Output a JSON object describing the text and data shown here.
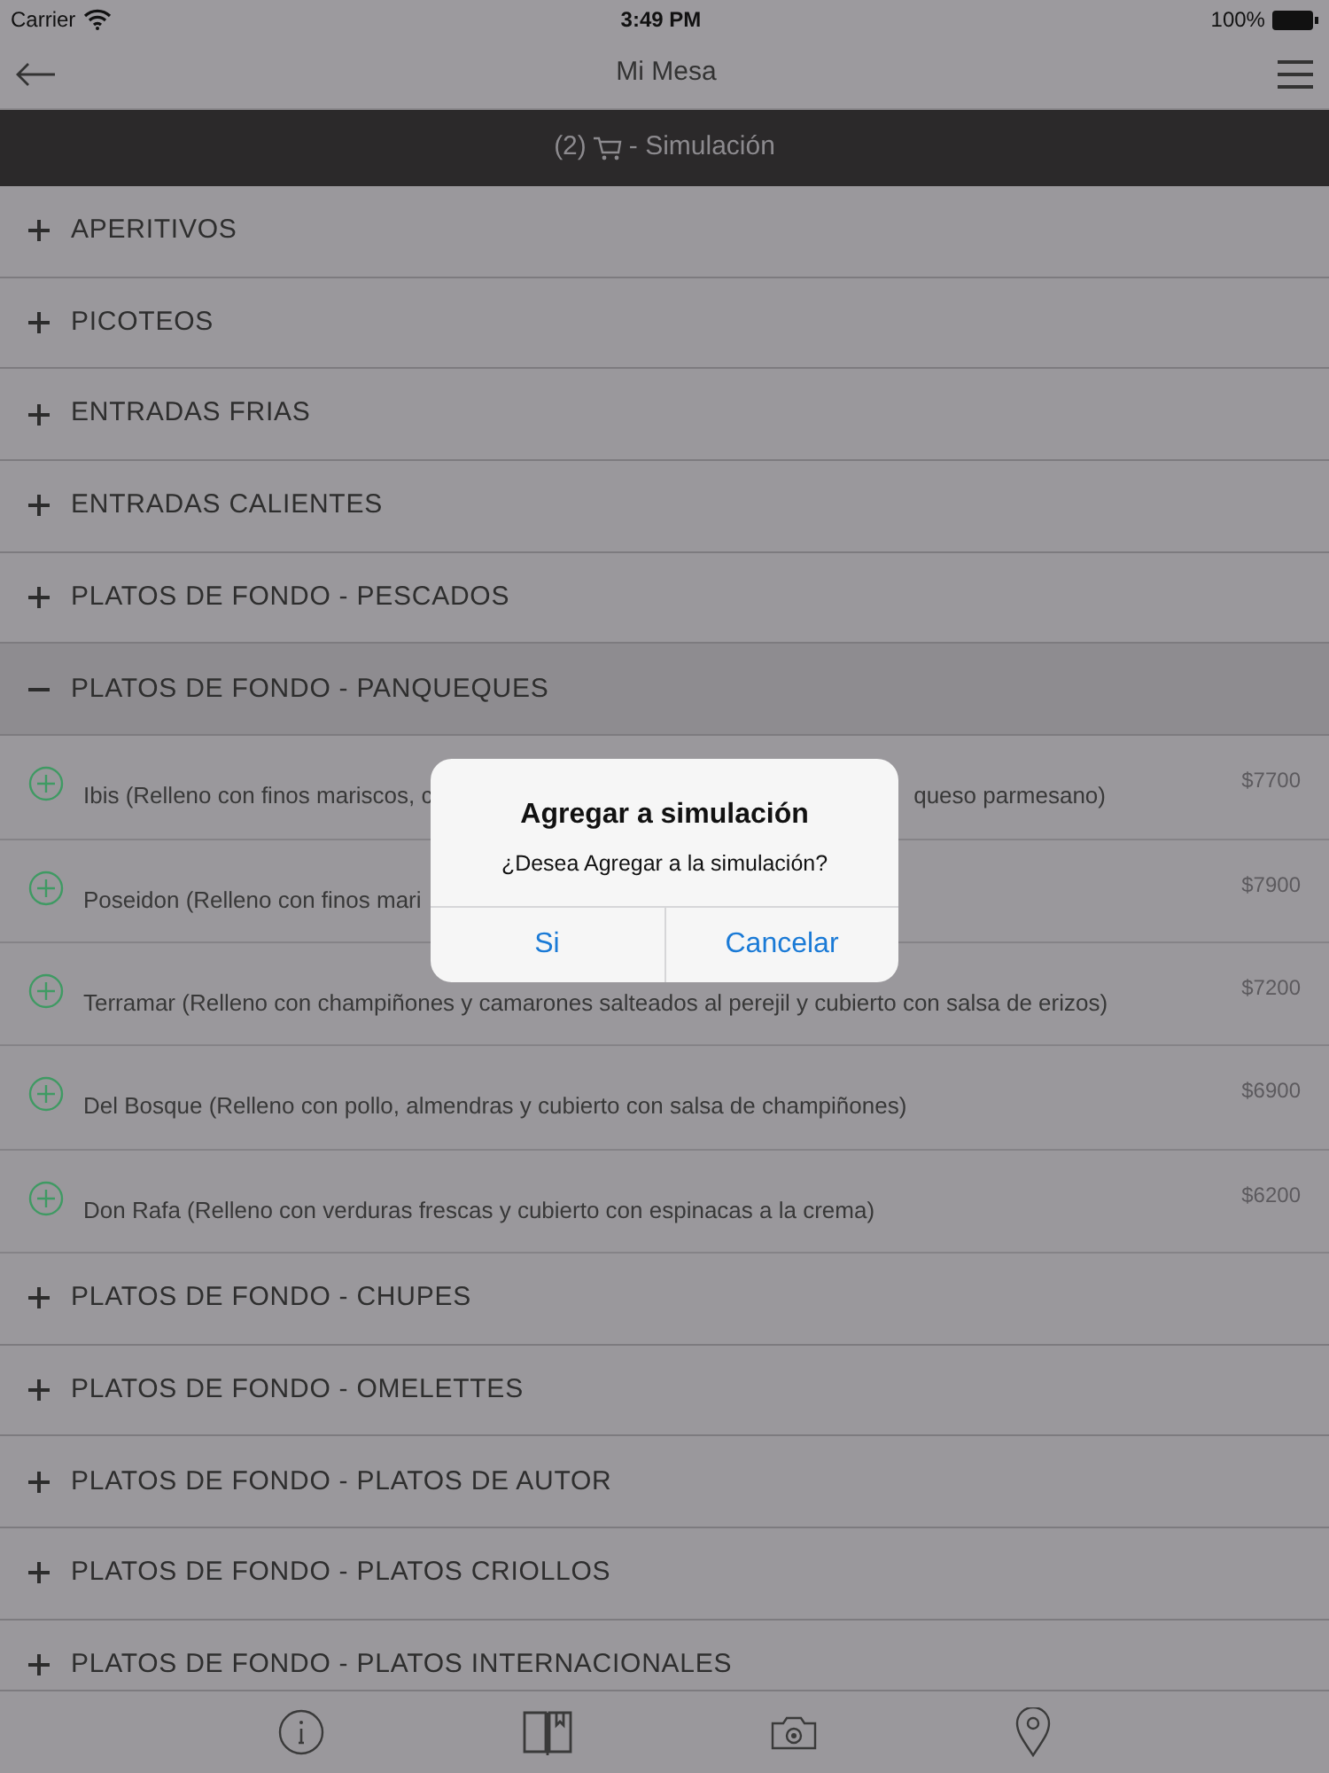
{
  "status_bar": {
    "carrier": "Carrier",
    "time": "3:49 PM",
    "battery": "100%"
  },
  "nav": {
    "title": "Mi Mesa"
  },
  "cart_bar": {
    "count": "(2)",
    "label": "- Simulación"
  },
  "categories": [
    {
      "label": "APERITIVOS",
      "expanded": false
    },
    {
      "label": "PICOTEOS",
      "expanded": false
    },
    {
      "label": "ENTRADAS FRIAS",
      "expanded": false
    },
    {
      "label": "ENTRADAS CALIENTES",
      "expanded": false
    },
    {
      "label": "PLATOS DE FONDO - PESCADOS",
      "expanded": false
    },
    {
      "label": "PLATOS DE FONDO - PANQUEQUES",
      "expanded": true,
      "items": [
        {
          "text": "Ibis (Relleno con finos mariscos, c",
          "text_end": "queso parmesano)",
          "price": "$7700"
        },
        {
          "text": "Poseidon (Relleno con finos mari",
          "price": "$7900"
        },
        {
          "text": "Terramar (Relleno con champiñones y camarones salteados al perejil y cubierto con salsa de erizos)",
          "price": "$7200"
        },
        {
          "text": "Del Bosque (Relleno con pollo, almendras y cubierto con salsa de champiñones)",
          "price": "$6900"
        },
        {
          "text": "Don Rafa (Relleno con verduras frescas y cubierto con espinacas a la crema)",
          "price": "$6200"
        }
      ]
    },
    {
      "label": "PLATOS DE FONDO - CHUPES",
      "expanded": false
    },
    {
      "label": "PLATOS DE FONDO - OMELETTES",
      "expanded": false
    },
    {
      "label": "PLATOS DE FONDO - PLATOS DE AUTOR",
      "expanded": false
    },
    {
      "label": "PLATOS DE FONDO - PLATOS CRIOLLOS",
      "expanded": false
    },
    {
      "label": "PLATOS DE FONDO - PLATOS INTERNACIONALES",
      "expanded": false
    }
  ],
  "dialog": {
    "title": "Agregar a simulación",
    "message": "¿Desea Agregar a la simulación?",
    "buttons": [
      "Si",
      "Cancelar"
    ]
  }
}
